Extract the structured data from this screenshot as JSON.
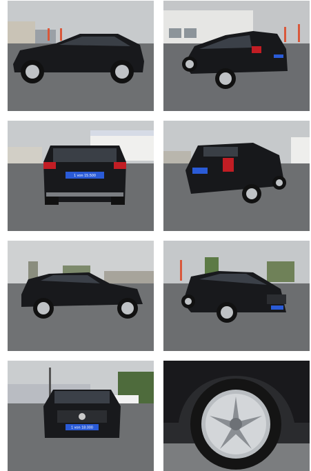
{
  "gallery": {
    "photos": [
      {
        "label": "side view left",
        "plate": ""
      },
      {
        "label": "rear three-quarter",
        "plate": ""
      },
      {
        "label": "rear view",
        "plate": "1 von 15.500"
      },
      {
        "label": "rear three-quarter right",
        "plate": ""
      },
      {
        "label": "side profile",
        "plate": ""
      },
      {
        "label": "front three-quarter",
        "plate": ""
      },
      {
        "label": "front view",
        "plate": "1 von 18.000"
      },
      {
        "label": "wheel detail",
        "plate": ""
      }
    ],
    "colors": {
      "sky": "#c9ccce",
      "asphalt": "#6f7173",
      "car": "#1a1b1e",
      "taillight": "#c21d24",
      "plate": "#2a5bd7"
    }
  }
}
